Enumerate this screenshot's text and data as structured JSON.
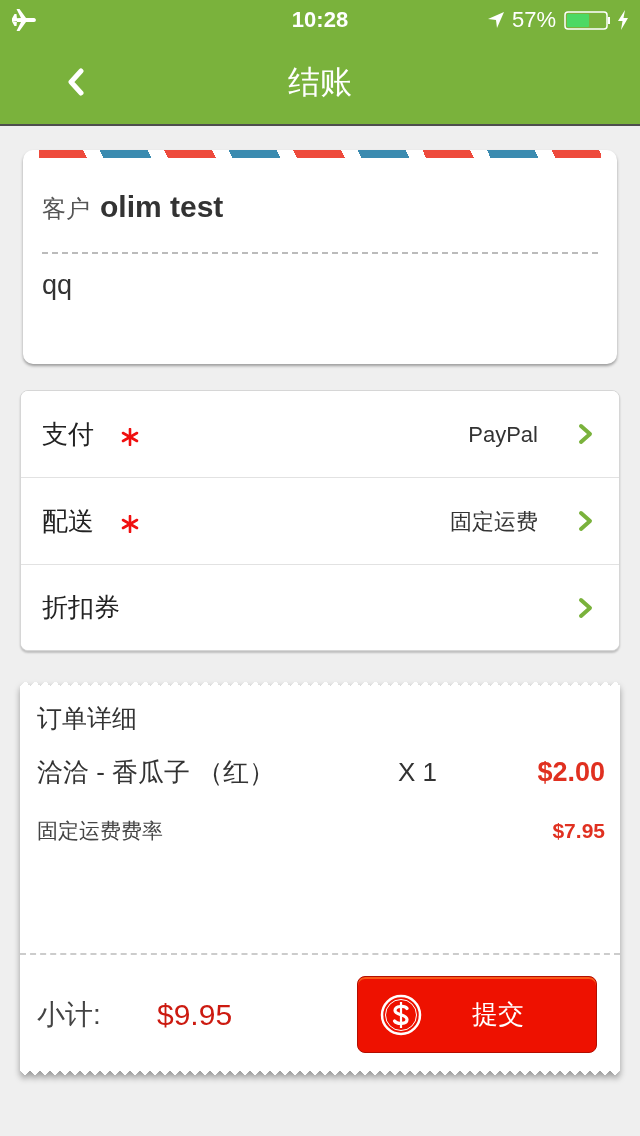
{
  "status_bar": {
    "airplane_mode": true,
    "time": "10:28",
    "location_services": true,
    "battery_text": "57%",
    "charging": true
  },
  "nav": {
    "title": "结账"
  },
  "customer": {
    "label": "客户",
    "name": "olim test",
    "note": "qq"
  },
  "options": [
    {
      "label": "支付",
      "required": true,
      "value": "PayPal"
    },
    {
      "label": "配送",
      "required": true,
      "value": "固定运费"
    },
    {
      "label": "折扣券",
      "required": false
    }
  ],
  "order": {
    "title": "订单详细",
    "items": [
      {
        "name": "洽洽 - 香瓜子 （红）",
        "quantity": "X 1",
        "price": "$2.00"
      }
    ],
    "fees": [
      {
        "label": "固定运费费率",
        "amount": "$7.95"
      }
    ],
    "subtotal": {
      "label": "小计:",
      "amount": "$9.95"
    },
    "submit": {
      "label": "提交"
    }
  }
}
